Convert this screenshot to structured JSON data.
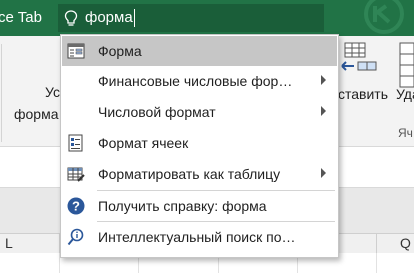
{
  "titlebar": {
    "office_tab_label": "ce Tab",
    "search_value": "форма"
  },
  "ribbon": {
    "left_text_1": "Ус",
    "left_text_2": "форма",
    "insert_label": "ставить",
    "delete_label": "Уда",
    "group_label": "Яч"
  },
  "columns": {
    "left_label": "L",
    "right_label": "Q"
  },
  "menu": {
    "items": [
      {
        "label": "Форма",
        "icon": "form-icon",
        "submenu": false
      },
      {
        "label": "Финансовые числовые фор…",
        "icon": "none",
        "submenu": true
      },
      {
        "label": "Числовой формат",
        "icon": "none",
        "submenu": true
      },
      {
        "label": "Формат ячеек",
        "icon": "format-cells-icon",
        "submenu": false
      },
      {
        "label": "Форматировать как таблицу",
        "icon": "format-as-table-icon",
        "submenu": true
      },
      {
        "label": "Получить справку: форма",
        "icon": "help-icon",
        "submenu": false
      },
      {
        "label": "Интеллектуальный поиск по…",
        "icon": "smart-lookup-icon",
        "submenu": false
      }
    ]
  },
  "colors": {
    "titlebar": "#217346",
    "search_box": "#1a5e39",
    "selected_item": "#c6c6c6",
    "help_icon": "#2b579a"
  }
}
